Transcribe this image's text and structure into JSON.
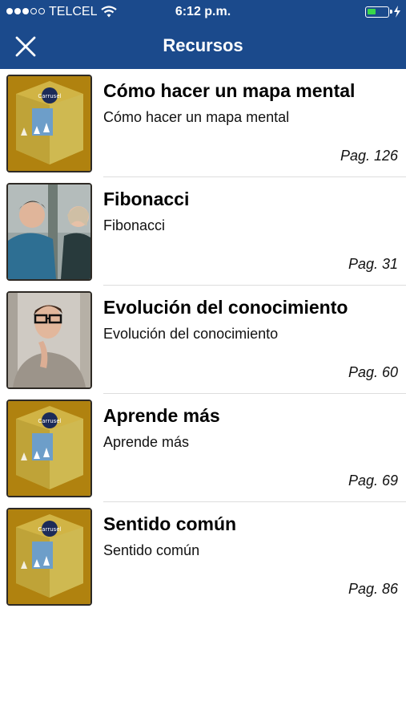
{
  "status": {
    "carrier": "TELCEL",
    "time": "6:12 p.m."
  },
  "nav": {
    "title": "Recursos",
    "close_icon": "close-icon"
  },
  "colors": {
    "nav_bg": "#1b4a8c",
    "battery": "#39d84a"
  },
  "items": [
    {
      "title": "Cómo hacer un mapa mental",
      "subtitle": "Cómo hacer un mapa mental",
      "page": "Pag. 126",
      "thumb": "carrusel-cube-thumbnail"
    },
    {
      "title": "Fibonacci",
      "subtitle": "Fibonacci",
      "page": "Pag. 31",
      "thumb": "two-people-photo-thumbnail"
    },
    {
      "title": "Evolución del conocimiento",
      "subtitle": "Evolución del conocimiento",
      "page": "Pag. 60",
      "thumb": "thinking-man-photo-thumbnail"
    },
    {
      "title": "Aprende más",
      "subtitle": "Aprende más",
      "page": "Pag. 69",
      "thumb": "carrusel-cube-thumbnail"
    },
    {
      "title": "Sentido común",
      "subtitle": "Sentido común",
      "page": "Pag. 86",
      "thumb": "carrusel-cube-thumbnail"
    }
  ]
}
